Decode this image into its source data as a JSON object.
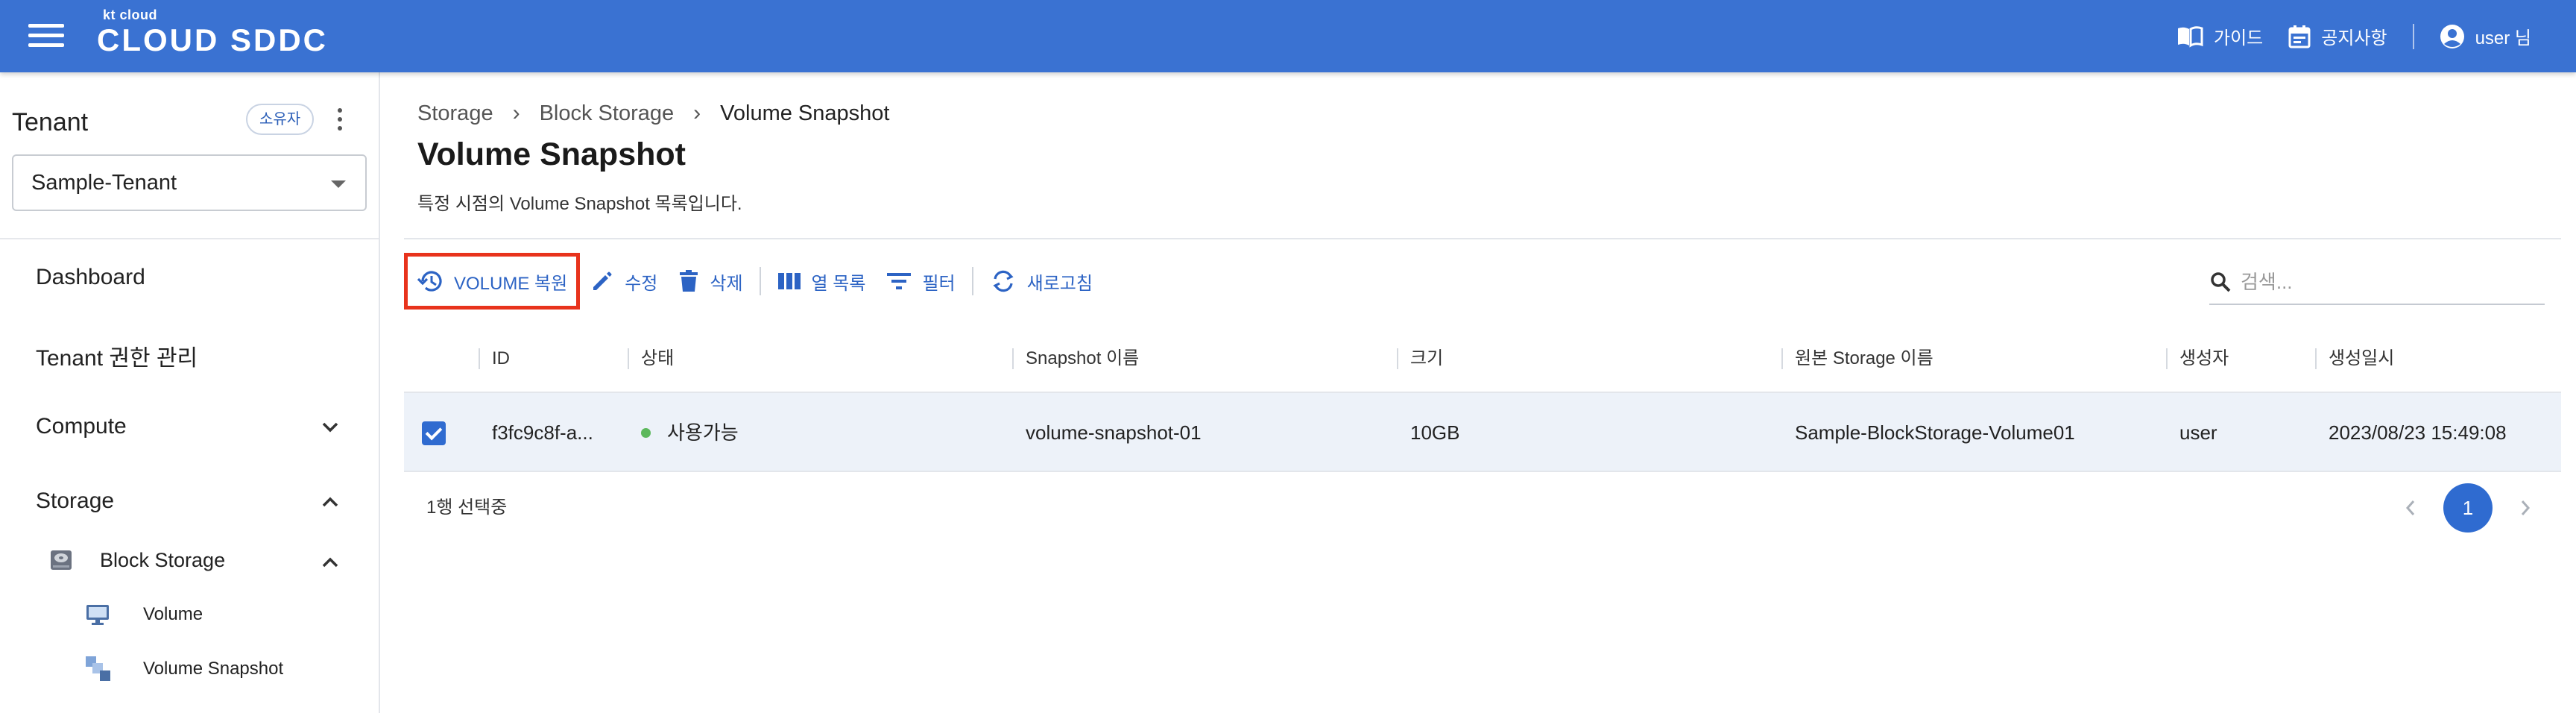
{
  "header": {
    "logo_small": "kt cloud",
    "logo_main": "CLOUD SDDC",
    "guide_label": "가이드",
    "notice_label": "공지사항",
    "user_label": "user 님"
  },
  "sidebar": {
    "tenant_title": "Tenant",
    "owner_badge": "소유자",
    "tenant_selected": "Sample-Tenant",
    "nav": {
      "dashboard": "Dashboard",
      "tenant_permission": "Tenant 권한 관리",
      "compute": "Compute",
      "storage": "Storage",
      "block_storage": "Block Storage",
      "volume": "Volume",
      "volume_snapshot": "Volume Snapshot"
    }
  },
  "main": {
    "breadcrumb": [
      "Storage",
      "Block Storage",
      "Volume Snapshot"
    ],
    "title": "Volume Snapshot",
    "description": "특정 시점의 Volume Snapshot 목록입니다.",
    "toolbar": {
      "restore": "VOLUME 복원",
      "edit": "수정",
      "delete": "삭제",
      "columns": "열 목록",
      "filter": "필터",
      "refresh": "새로고침"
    },
    "search_placeholder": "검색...",
    "table": {
      "headers": [
        "ID",
        "상태",
        "Snapshot 이름",
        "크기",
        "원본 Storage 이름",
        "생성자",
        "생성일시"
      ],
      "rows": [
        {
          "id": "f3fc9c8f-a...",
          "status": "사용가능",
          "name": "volume-snapshot-01",
          "size": "10GB",
          "source": "Sample-BlockStorage-Volume01",
          "creator": "user",
          "created": "2023/08/23 15:49:08",
          "checked": true
        }
      ]
    },
    "selection_text": "1행 선택중",
    "current_page": "1"
  },
  "colors": {
    "header_bg": "#3a72d2",
    "accent": "#2f6bd0",
    "highlight_border": "#e8331c",
    "status_available": "#5cb85c"
  }
}
